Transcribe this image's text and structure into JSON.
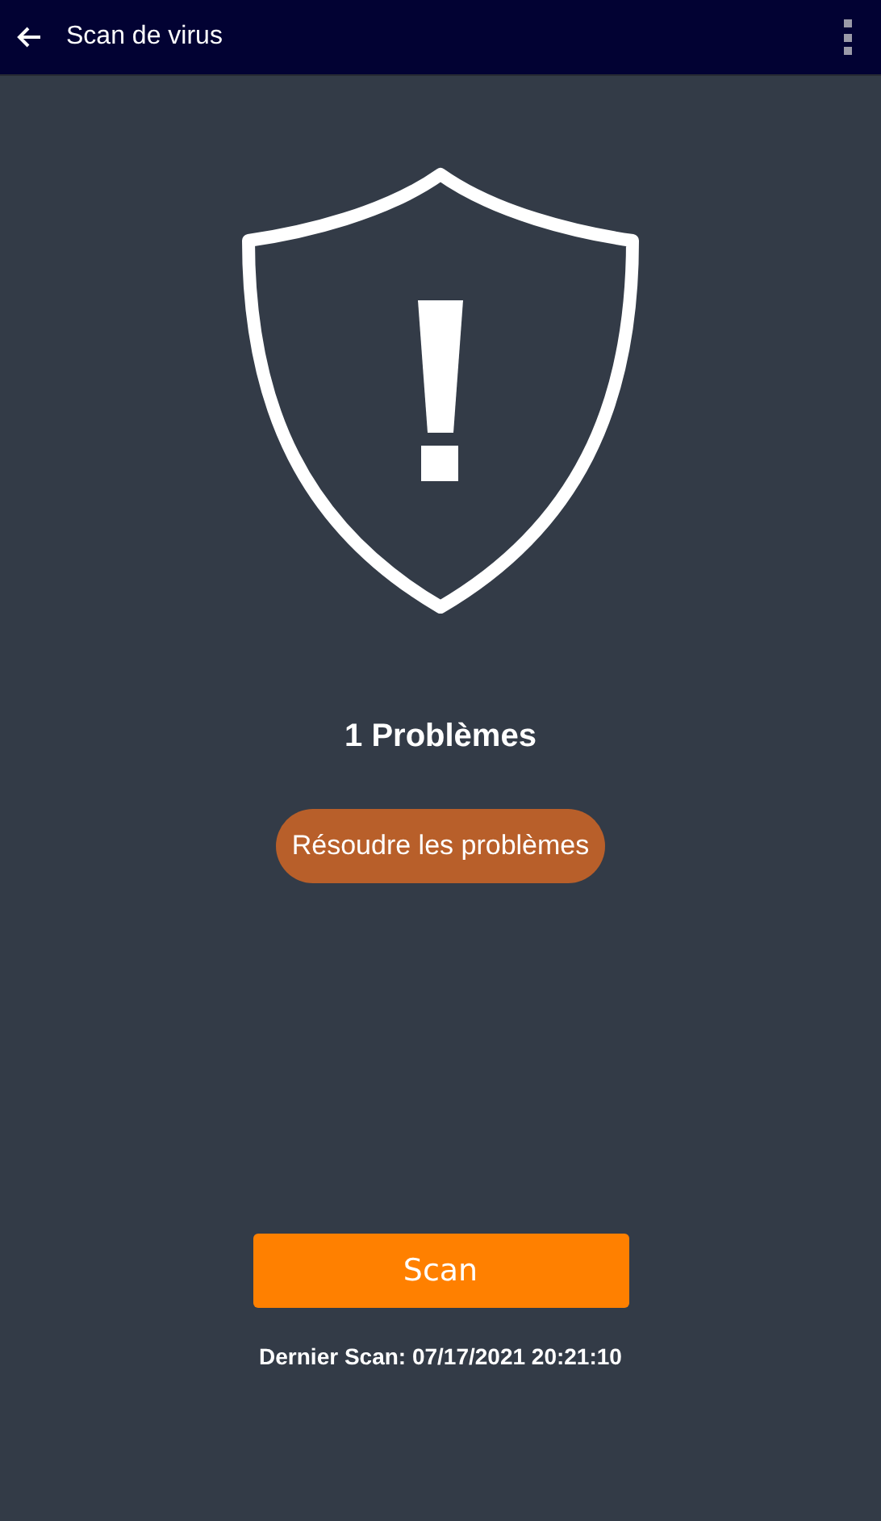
{
  "app_bar": {
    "title": "Scan de virus"
  },
  "status": {
    "title": "1 Problèmes"
  },
  "resolve_button": {
    "label": "Résoudre les problèmes"
  },
  "scan_button": {
    "label": "Scan"
  },
  "last_scan": "Dernier Scan: 07/17/2021 20:21:10"
}
